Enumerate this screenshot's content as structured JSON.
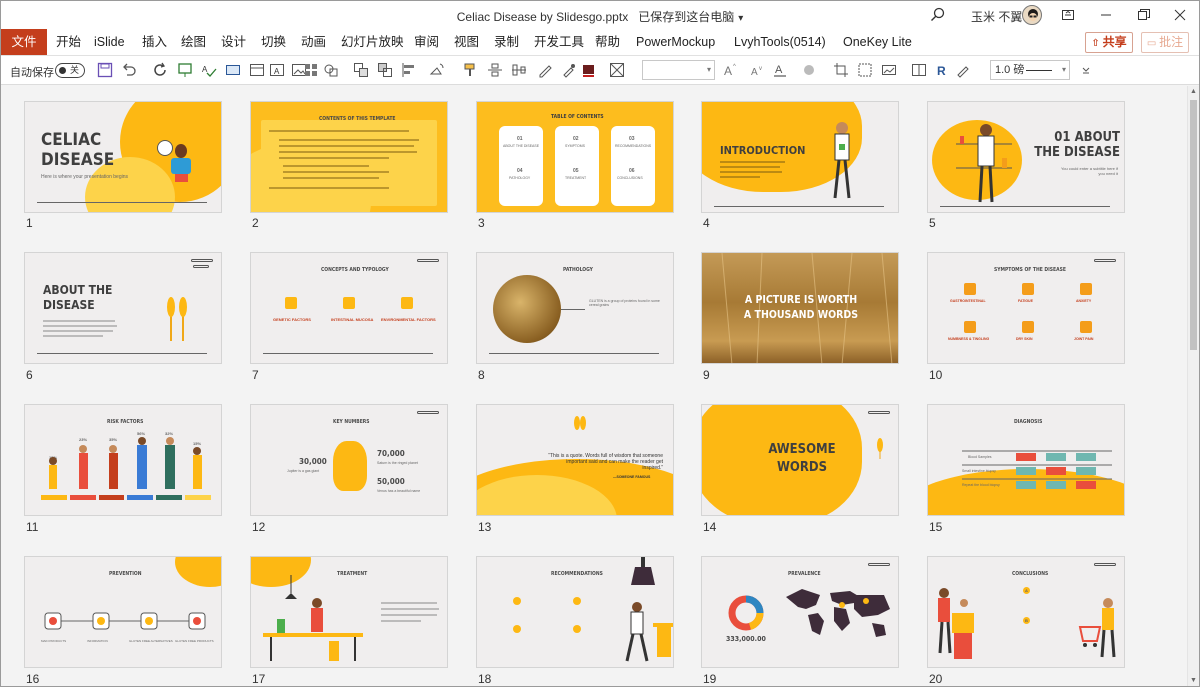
{
  "window": {
    "title": "Celiac Disease by Slidesgo.pptx",
    "save_status": "已保存到这台电脑",
    "save_chevron": "▾",
    "user_name": "玉米 不翼"
  },
  "tabs": [
    "文件",
    "开始",
    "iSlide",
    "插入",
    "绘图",
    "设计",
    "切换",
    "动画",
    "幻灯片放映",
    "审阅",
    "视图",
    "录制",
    "开发工具",
    "帮助",
    "PowerMockup",
    "LvyhTools(0514)",
    "OneKey Lite"
  ],
  "actions": {
    "share": "共享",
    "comment": "批注"
  },
  "toolbar": {
    "autosave_label": "自动保存",
    "autosave_state": "关",
    "font_combo": "",
    "line_weight": "1.0 磅"
  },
  "colors": {
    "accent": "#c43e1c",
    "brand_yellow": "#fdb813",
    "light_yellow": "#fdd34a",
    "slide_bg": "#f0eeee"
  },
  "slides": [
    {
      "num": "1",
      "title": "CELIAC DISEASE",
      "sub": "Here is where your presentation begins"
    },
    {
      "num": "2",
      "title": "CONTENTS OF THIS TEMPLATE"
    },
    {
      "num": "3",
      "title": "TABLE OF CONTENTS",
      "items": [
        "01",
        "02",
        "03",
        "04",
        "05",
        "06"
      ],
      "labels": [
        "ABOUT THE DISEASE",
        "SYMPTOMS",
        "RECOMMENDATIONS",
        "PATHOLOGY",
        "TREATMENT",
        "CONCLUSIONS"
      ]
    },
    {
      "num": "4",
      "title": "INTRODUCTION"
    },
    {
      "num": "5",
      "title": "01 ABOUT THE DISEASE",
      "sub": "You could enter a subtitle here if you need it"
    },
    {
      "num": "6",
      "title": "ABOUT THE DISEASE"
    },
    {
      "num": "7",
      "title": "CONCEPTS AND TYPOLOGY",
      "labels": [
        "GENETIC FACTORS",
        "INTESTINAL MUCOSA",
        "ENVIRONMENTAL FACTORS"
      ]
    },
    {
      "num": "8",
      "title": "PATHOLOGY",
      "sub": "GLUTEN is a group of proteins found in some cereal grains"
    },
    {
      "num": "9",
      "title": "A PICTURE IS WORTH A THOUSAND WORDS"
    },
    {
      "num": "10",
      "title": "SYMPTOMS OF THE DISEASE",
      "labels": [
        "GASTROINTESTINAL",
        "FATIGUE",
        "ANXIETY",
        "NUMBNESS & TINGLING",
        "DRY SKIN",
        "JOINT PAIN"
      ]
    },
    {
      "num": "11",
      "title": "RISK FACTORS",
      "values": [
        "15%",
        "23%",
        "35%",
        "56%",
        "32%",
        "15%"
      ],
      "labels": [
        "CELIAC",
        "ONE OF THE MAIN DISEASES",
        "AUTOIMMUNE DISEASES",
        "GENETIC FACTORS",
        "TYPE 1 DIABETES",
        "DOWN SYNDROME"
      ]
    },
    {
      "num": "12",
      "title": "KEY NUMBERS",
      "values": [
        "30,000",
        "70,000",
        "50,000"
      ],
      "subs": [
        "Jupiter is a gas giant",
        "Saturn is the ringed planet",
        "Venus has a beautiful name"
      ]
    },
    {
      "num": "13",
      "title": "“This is a quote. Words full of wisdom that someone important said and can make the reader get inspired.”",
      "sub": "—SOMEONE FAMOUS"
    },
    {
      "num": "14",
      "title": "AWESOME WORDS"
    },
    {
      "num": "15",
      "title": "DIAGNOSIS",
      "labels": [
        "Blood Samples",
        "Small intestine biopsy",
        "Repeat the blood biopsy"
      ]
    },
    {
      "num": "16",
      "title": "PREVENTION",
      "labels": [
        "MAIN PRODUCTS",
        "INFORMATION",
        "GLUTEN FREE ALTERNATIVES",
        "GLUTEN FREE PRODUCTS"
      ]
    },
    {
      "num": "17",
      "title": "TREATMENT"
    },
    {
      "num": "18",
      "title": "RECOMMENDATIONS"
    },
    {
      "num": "19",
      "title": "PREVALENCE",
      "values": [
        "333,000.00"
      ]
    },
    {
      "num": "20",
      "title": "CONCLUSIONS",
      "items": [
        "A",
        "B"
      ]
    }
  ]
}
